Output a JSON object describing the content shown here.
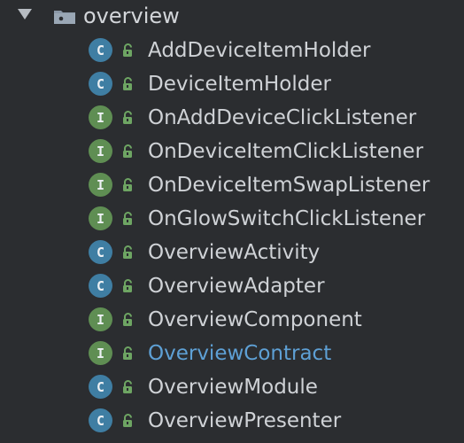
{
  "folder": {
    "name": "overview"
  },
  "items": [
    {
      "label": "AddDeviceItemHolder",
      "type": "C"
    },
    {
      "label": "DeviceItemHolder",
      "type": "C"
    },
    {
      "label": "OnAddDeviceClickListener",
      "type": "I"
    },
    {
      "label": "OnDeviceItemClickListener",
      "type": "I"
    },
    {
      "label": "OnDeviceItemSwapListener",
      "type": "I"
    },
    {
      "label": "OnGlowSwitchClickListener",
      "type": "I"
    },
    {
      "label": "OverviewActivity",
      "type": "C"
    },
    {
      "label": "OverviewAdapter",
      "type": "C"
    },
    {
      "label": "OverviewComponent",
      "type": "I"
    },
    {
      "label": "OverviewContract",
      "type": "I",
      "highlighted": true
    },
    {
      "label": "OverviewModule",
      "type": "C"
    },
    {
      "label": "OverviewPresenter",
      "type": "C"
    }
  ],
  "colors": {
    "background": "#2b2d30",
    "class_badge": "#3f7ea3",
    "interface_badge": "#5f8e53",
    "lock_icon": "#6ea563",
    "highlight_text": "#5ea0d5"
  }
}
